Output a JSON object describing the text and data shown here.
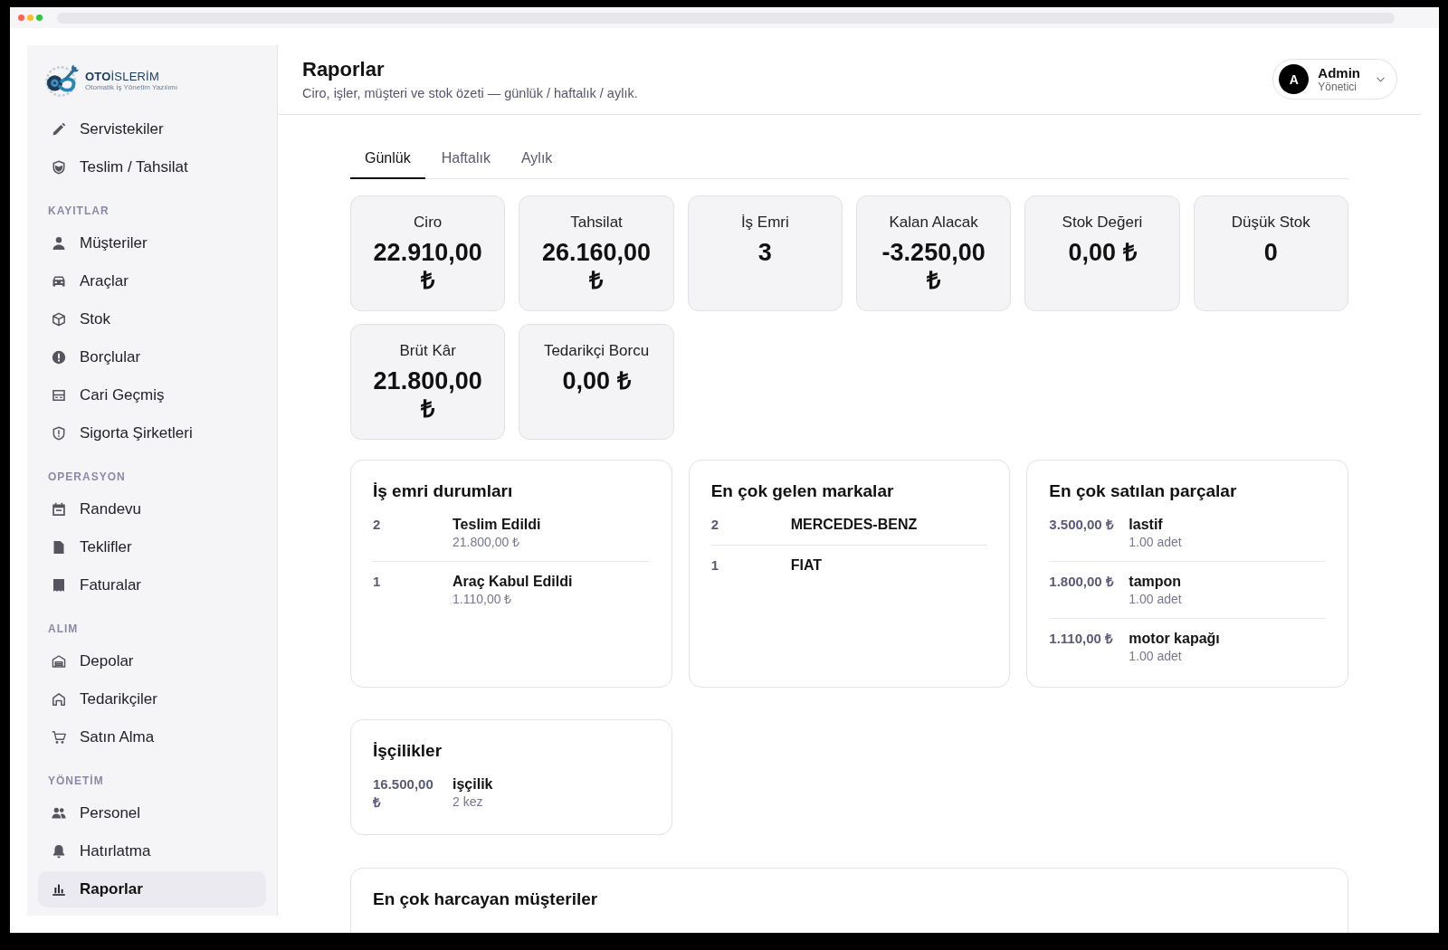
{
  "sidebar": {
    "logo": {
      "name": "**OTO**İSLERİM",
      "tagline": "Otomatik İş Yönetim Yazılımı"
    },
    "sections": [
      {
        "items": [
          {
            "label": "Servistekiler",
            "selected": false
          },
          {
            "label": "Teslim / Tahsilat",
            "selected": false
          }
        ]
      },
      {
        "heading": "KAYITLAR",
        "items": [
          {
            "label": "Müşteriler",
            "selected": false
          },
          {
            "label": "Araçlar",
            "selected": false
          },
          {
            "label": "Stok",
            "selected": false
          },
          {
            "label": "Borçlular",
            "selected": false
          },
          {
            "label": "Cari Geçmiş",
            "selected": false
          },
          {
            "label": "Sigorta Şirketleri",
            "selected": false
          }
        ]
      },
      {
        "heading": "OPERASYON",
        "items": [
          {
            "label": "Randevu",
            "selected": false
          },
          {
            "label": "Teklifler",
            "selected": false
          },
          {
            "label": "Faturalar",
            "selected": false
          }
        ]
      },
      {
        "heading": "ALIM",
        "items": [
          {
            "label": "Depolar",
            "selected": false
          },
          {
            "label": "Tedarikçiler",
            "selected": false
          },
          {
            "label": "Satın Alma",
            "selected": false
          }
        ]
      },
      {
        "heading": "YÖNETİM",
        "items": [
          {
            "label": "Personel",
            "selected": false
          },
          {
            "label": "Hatırlatma",
            "selected": false
          },
          {
            "label": "Raporlar",
            "selected": true
          }
        ]
      }
    ]
  },
  "header": {
    "title": "Raporlar",
    "subtitle": "Ciro, işler, müşteri ve stok özeti — günlük / haftalık / aylık.",
    "user": {
      "initial": "A",
      "name": "Admin",
      "role": "Yönetici"
    }
  },
  "tabs": [
    {
      "label": "Günlük",
      "selected": true
    },
    {
      "label": "Haftalık",
      "selected": false
    },
    {
      "label": "Aylık",
      "selected": false
    }
  ],
  "stats": [
    {
      "label": "Ciro",
      "value": "22.910,00 ₺"
    },
    {
      "label": "Tahsilat",
      "value": "26.160,00 ₺"
    },
    {
      "label": "İş Emri",
      "value": "3"
    },
    {
      "label": "Kalan Alacak",
      "value": "-3.250,00 ₺"
    },
    {
      "label": "Stok Değeri",
      "value": "0,00 ₺"
    },
    {
      "label": "Düşük Stok",
      "value": "0"
    },
    {
      "label": "Brüt Kâr",
      "value": "21.800,00 ₺"
    },
    {
      "label": "Tedarikçi Borcu",
      "value": "0,00 ₺"
    }
  ],
  "panels": [
    {
      "title": "İş emri durumları",
      "rows": [
        {
          "figure": "2",
          "name": "Teslim Edildi",
          "note": "21.800,00 ₺"
        },
        {
          "figure": "1",
          "name": "Araç Kabul Edildi",
          "note": "1.110,00 ₺"
        }
      ]
    },
    {
      "title": "En çok gelen markalar",
      "rows": [
        {
          "figure": "2",
          "name": "MERCEDES-BENZ"
        },
        {
          "figure": "1",
          "name": "FIAT"
        }
      ]
    },
    {
      "title": "En çok satılan parçalar",
      "rows": [
        {
          "figure": "3.500,00 ₺",
          "name": "lastif",
          "note": "1.00 adet"
        },
        {
          "figure": "1.800,00 ₺",
          "name": "tampon",
          "note": "1.00 adet"
        },
        {
          "figure": "1.110,00 ₺",
          "name": "motor kapağı",
          "note": "1.00 adet"
        }
      ]
    },
    {
      "title": "İşçilikler",
      "rows": [
        {
          "figure": "16.500,00 ₺",
          "name": "işçilik",
          "note": "2 kez"
        }
      ]
    }
  ],
  "top_customers": {
    "title": "En çok harcayan müşteriler"
  }
}
